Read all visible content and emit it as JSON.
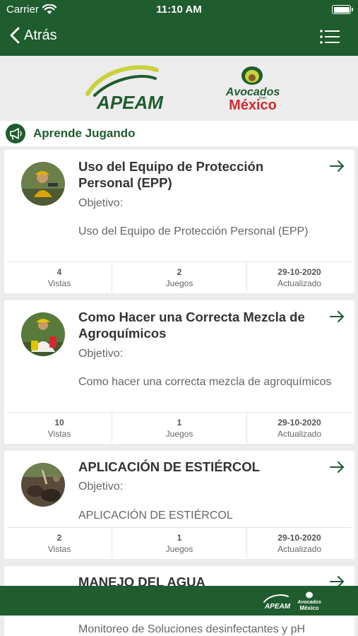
{
  "status": {
    "carrier": "Carrier",
    "time": "11:10 AM"
  },
  "nav": {
    "back_label": "Atrás"
  },
  "logos": {
    "apeam": "APEAM",
    "avocados_line1": "Avocados",
    "avocados_from": "from",
    "avocados_line2": "México"
  },
  "section": {
    "title": "Aprende Jugando"
  },
  "cards": [
    {
      "title": "Uso del Equipo de Protección Personal (EPP)",
      "objective_label": "Objetivo:",
      "description": "Uso del Equipo de Protección Personal (EPP)",
      "stats": [
        {
          "value": "4",
          "label": "Vistas"
        },
        {
          "value": "2",
          "label": "Juegos"
        },
        {
          "value": "29-10-2020",
          "label": "Actualizado"
        }
      ]
    },
    {
      "title": "Como Hacer una Correcta Mezcla de Agroquímicos",
      "objective_label": "Objetivo:",
      "description": "Como hacer una correcta mezcla de agroquímicos",
      "stats": [
        {
          "value": "10",
          "label": "Vistas"
        },
        {
          "value": "1",
          "label": "Juegos"
        },
        {
          "value": "29-10-2020",
          "label": "Actualizado"
        }
      ]
    },
    {
      "title": "APLICACIÓN DE ESTIÉRCOL",
      "objective_label": "Objetivo:",
      "description": "APLICACIÓN DE ESTIÉRCOL",
      "stats": [
        {
          "value": "2",
          "label": "Vistas"
        },
        {
          "value": "1",
          "label": "Juegos"
        },
        {
          "value": "29-10-2020",
          "label": "Actualizado"
        }
      ]
    },
    {
      "title": "MANEJO DEL AGUA",
      "description": "Monitoreo de Soluciones desinfectantes y pH"
    }
  ],
  "footer": {
    "apeam": "APEAM",
    "avocados_line1": "Avocados",
    "avocados_line2": "México"
  },
  "colors": {
    "brand_green": "#1f5c2e",
    "avocados_red": "#d7282f",
    "apeam_yellow": "#c9d23a"
  }
}
